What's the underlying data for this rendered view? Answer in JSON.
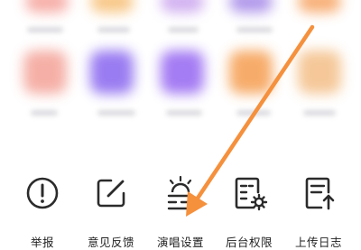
{
  "actions": [
    {
      "label": "举报",
      "icon": "exclamation-circle-icon"
    },
    {
      "label": "意见反馈",
      "icon": "edit-square-icon"
    },
    {
      "label": "演唱设置",
      "icon": "singer-settings-icon"
    },
    {
      "label": "后台权限",
      "icon": "document-gear-icon"
    },
    {
      "label": "上传日志",
      "icon": "document-upload-icon"
    }
  ],
  "colors": {
    "arrow": "#f5903d",
    "icon_stroke": "#2b2b2b",
    "label_text": "#1f1f1f"
  }
}
